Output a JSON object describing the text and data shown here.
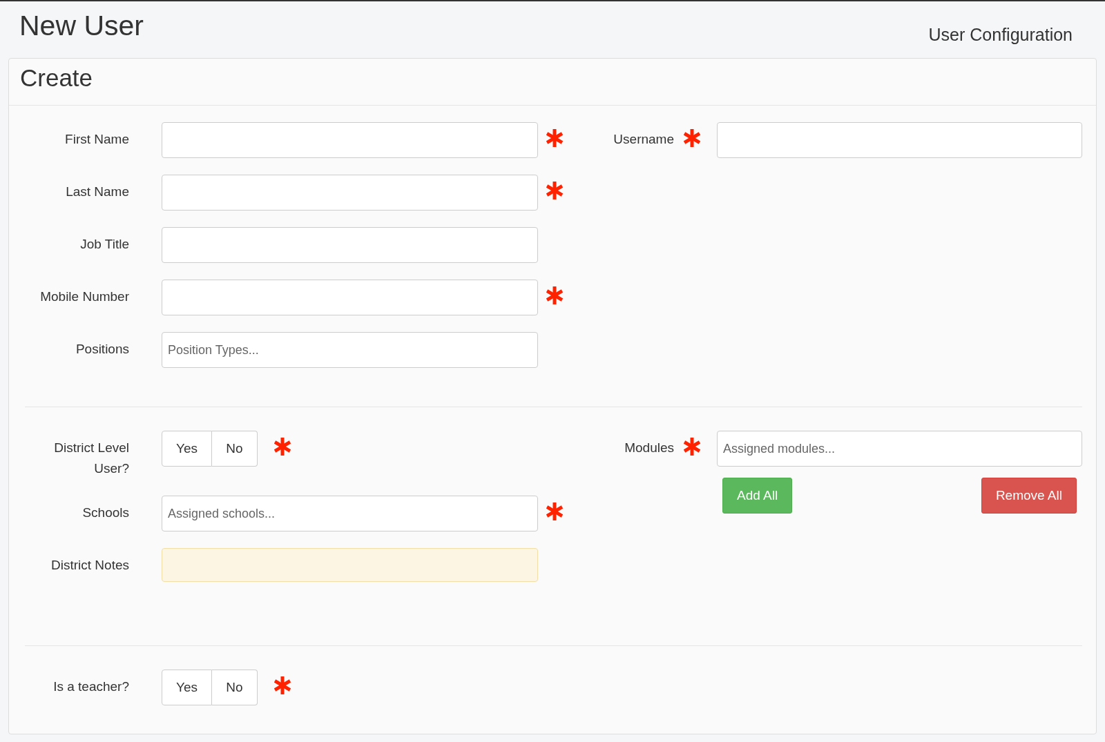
{
  "header": {
    "title": "New User",
    "breadcrumb": "User Configuration"
  },
  "panel": {
    "title": "Create",
    "sections": [
      {
        "left": [
          {
            "kind": "text",
            "label": "First Name",
            "required": true
          },
          {
            "kind": "text",
            "label": "Last Name",
            "required": true
          },
          {
            "kind": "text",
            "label": "Job Title",
            "required": false
          },
          {
            "kind": "text",
            "label": "Mobile Number",
            "required": true
          },
          {
            "kind": "text",
            "label": "Positions",
            "placeholder": "Position Types...",
            "required": false
          }
        ],
        "right": [
          {
            "kind": "text",
            "label": "Username",
            "required": true
          }
        ]
      },
      {
        "left": [
          {
            "kind": "toggle",
            "label": "District Level User?",
            "required": true,
            "options": [
              {
                "label": "Yes",
                "selected": false
              },
              {
                "label": "No",
                "selected": false
              }
            ]
          },
          {
            "kind": "text",
            "label": "Schools",
            "placeholder": "Assigned schools...",
            "required": true
          },
          {
            "kind": "notes",
            "label": "District Notes",
            "required": false
          }
        ],
        "right": [
          {
            "kind": "text",
            "label": "Modules",
            "placeholder": "Assigned modules...",
            "required": true,
            "actions": [
              {
                "label": "Add All",
                "kind": "success"
              },
              {
                "label": "Remove All",
                "kind": "danger"
              }
            ]
          }
        ]
      },
      {
        "left": [
          {
            "kind": "toggle",
            "label": "Is a teacher?",
            "required": true,
            "options": [
              {
                "label": "Yes",
                "selected": false
              },
              {
                "label": "No",
                "selected": false
              }
            ]
          }
        ]
      }
    ]
  }
}
